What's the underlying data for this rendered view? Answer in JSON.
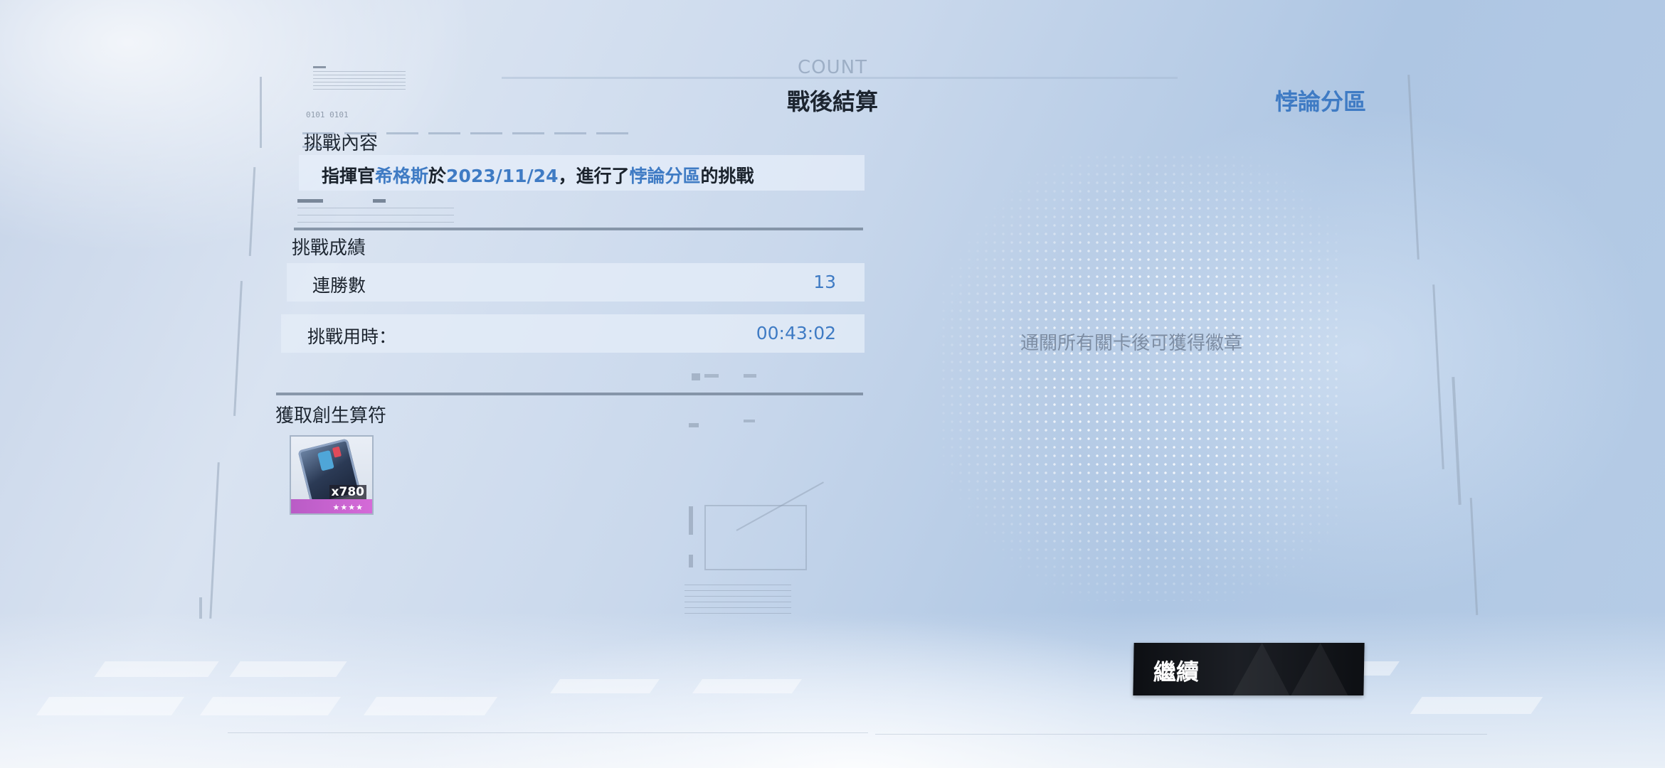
{
  "header": {
    "count_label": "COUNT",
    "title": "戰後結算",
    "mode_name": "悖論分區"
  },
  "deco": {
    "binary": "0101 0101"
  },
  "challenge_content": {
    "label": "挑戰內容",
    "prefix": "指揮官",
    "commander": "希格斯",
    "on": "於",
    "date": "2023/11/24",
    "middle": "，進行了",
    "mode": "悖論分區",
    "suffix": "的挑戰"
  },
  "challenge_results": {
    "label": "挑戰成績",
    "win_streak_label": "連勝數",
    "win_streak_value": "13",
    "time_label": "挑戰用時：",
    "time_value": "00:43:02"
  },
  "rewards": {
    "label": "獲取創生算符",
    "items": [
      {
        "name": "創生算符",
        "quantity": "x780",
        "stars": "★★★★"
      }
    ]
  },
  "badge": {
    "hint": "通關所有關卡後可獲得徽章"
  },
  "footer": {
    "continue_label": "繼續"
  },
  "colors": {
    "accent": "#3f7bc4",
    "text_dark": "#1b232d",
    "button_bg": "#111317",
    "rarity": "#c862cf"
  }
}
